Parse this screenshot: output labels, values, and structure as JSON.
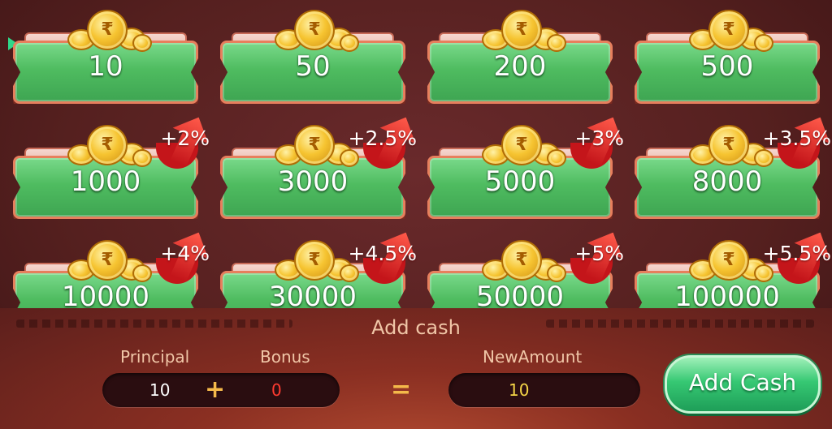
{
  "cards": [
    {
      "amount": "10",
      "bonus": ""
    },
    {
      "amount": "50",
      "bonus": ""
    },
    {
      "amount": "200",
      "bonus": ""
    },
    {
      "amount": "500",
      "bonus": ""
    },
    {
      "amount": "1000",
      "bonus": "+2%"
    },
    {
      "amount": "3000",
      "bonus": "+2.5%"
    },
    {
      "amount": "5000",
      "bonus": "+3%"
    },
    {
      "amount": "8000",
      "bonus": "+3.5%"
    },
    {
      "amount": "10000",
      "bonus": "+4%"
    },
    {
      "amount": "30000",
      "bonus": "+4.5%"
    },
    {
      "amount": "50000",
      "bonus": "+5%"
    },
    {
      "amount": "100000",
      "bonus": "+5.5%"
    }
  ],
  "selected_card": "10",
  "coin_icon": "rupee-coin-icon",
  "bonus_icon": "red-up-arrow-icon",
  "panel": {
    "title": "Add cash",
    "principal_label": "Principal",
    "bonus_label": "Bonus",
    "new_amount_label": "NewAmount",
    "principal_value": "10",
    "bonus_value": "0",
    "new_amount_value": "10",
    "plus_sign": "+",
    "equals_sign": "=",
    "add_button_label": "Add Cash"
  },
  "colors": {
    "background": "#55201f",
    "card_green": "#4fbc60",
    "card_border": "#e77f5d",
    "bonus_red": "#c4151a",
    "principal_text": "#ffffff",
    "bonus_text": "#ff3b30",
    "new_amount_text": "#f5d547",
    "operator": "#f4b94a",
    "button_green": "#36c873"
  }
}
